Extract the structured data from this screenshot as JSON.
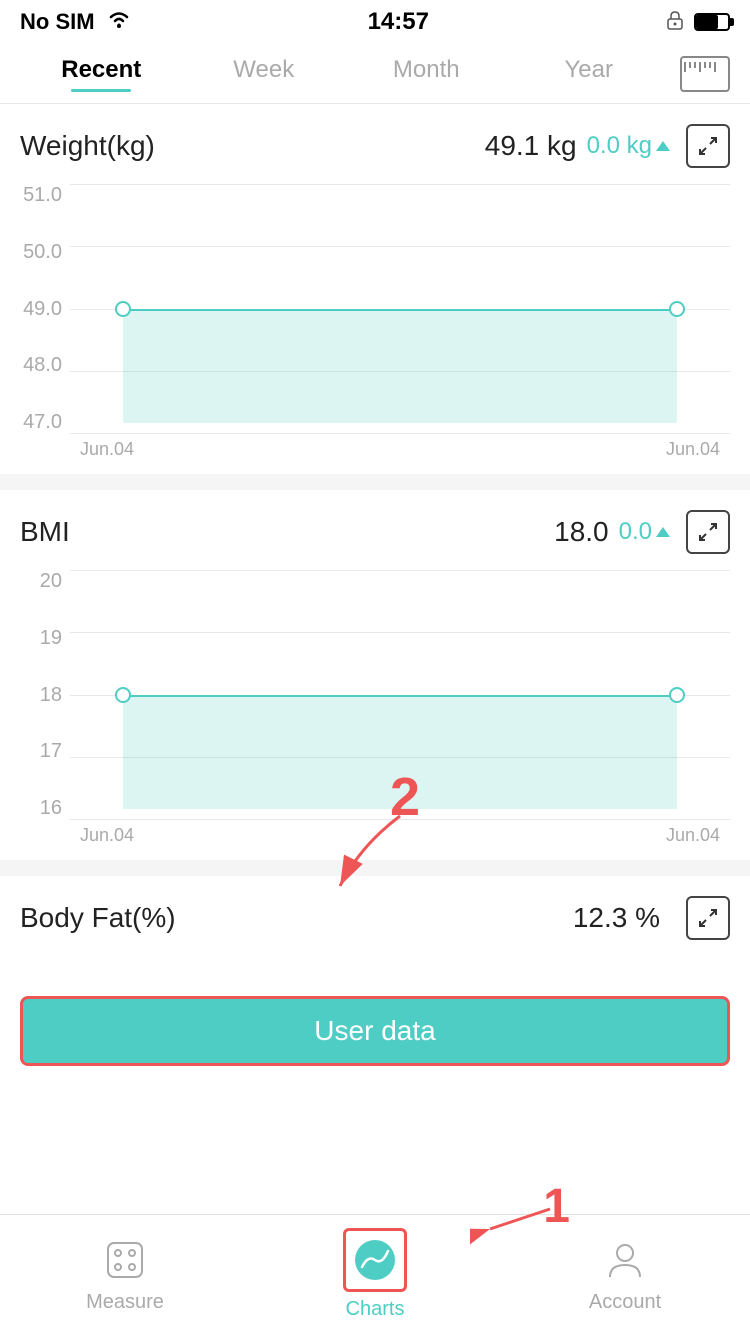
{
  "statusBar": {
    "carrier": "No SIM",
    "time": "14:57"
  },
  "topTabs": {
    "items": [
      {
        "id": "recent",
        "label": "Recent",
        "active": true
      },
      {
        "id": "week",
        "label": "Week",
        "active": false
      },
      {
        "id": "month",
        "label": "Month",
        "active": false
      },
      {
        "id": "year",
        "label": "Year",
        "active": false
      }
    ]
  },
  "weightChart": {
    "title": "Weight(kg)",
    "value": "49.1 kg",
    "change": "0.0 kg",
    "yLabels": [
      "51.0",
      "50.0",
      "49.0",
      "48.0",
      "47.0"
    ],
    "xLabels": [
      "Jun.04",
      "Jun.04"
    ],
    "fillTop": "49.0",
    "fillBottom": "47.0"
  },
  "bmiChart": {
    "title": "BMI",
    "value": "18.0",
    "change": "0.0",
    "yLabels": [
      "20",
      "19",
      "18",
      "17",
      "16"
    ],
    "xLabels": [
      "Jun.04",
      "Jun.04"
    ],
    "fillTop": "18",
    "fillBottom": "16"
  },
  "userDataBanner": {
    "label": "User data"
  },
  "bottomNav": {
    "items": [
      {
        "id": "measure",
        "label": "Measure",
        "active": false
      },
      {
        "id": "charts",
        "label": "Charts",
        "active": true
      },
      {
        "id": "account",
        "label": "Account",
        "active": false
      }
    ]
  },
  "annotations": {
    "number1": "1",
    "number2": "2"
  }
}
